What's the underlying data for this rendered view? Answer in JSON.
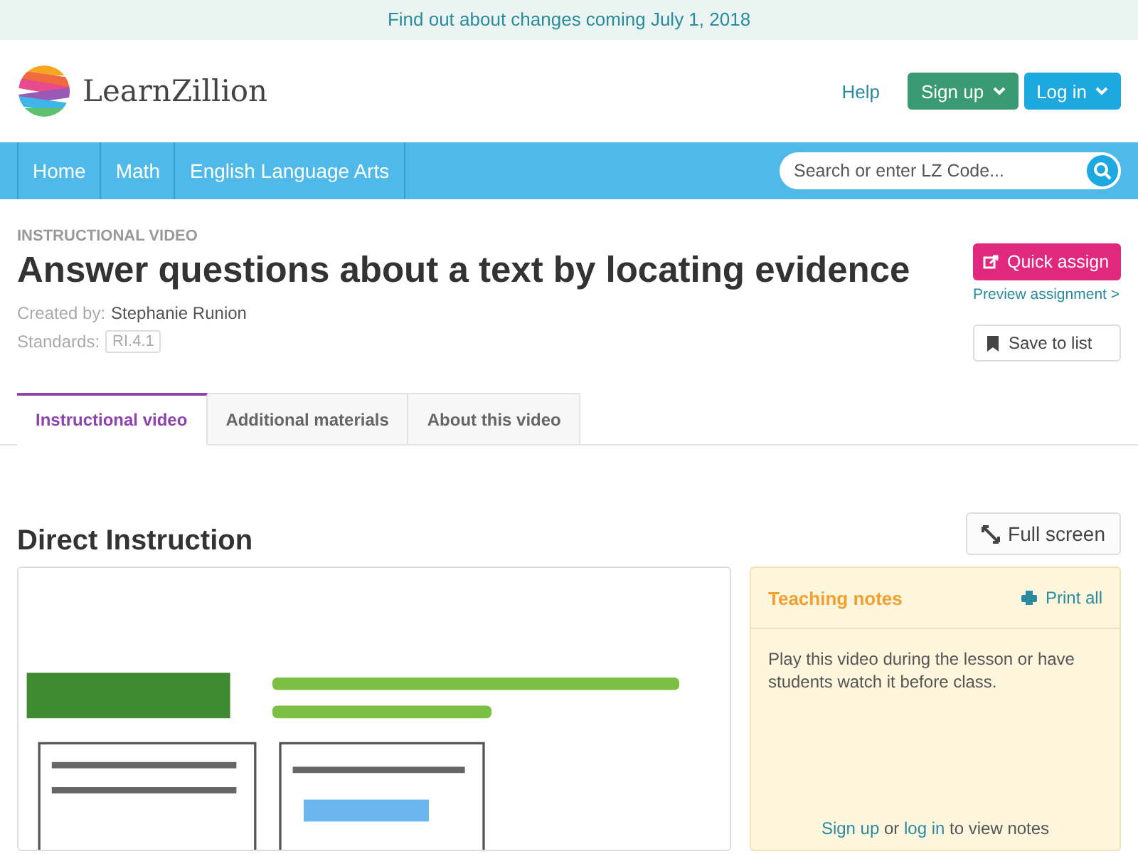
{
  "banner": {
    "text": "Find out about changes coming July 1, 2018"
  },
  "header": {
    "logo": "LearnZillion",
    "help": "Help",
    "buttons": [
      {
        "label": "Sign up",
        "kind": "green"
      },
      {
        "label": "Log in",
        "kind": "blue"
      }
    ]
  },
  "nav": {
    "items": [
      "Home",
      "Math",
      "English Language Arts"
    ],
    "search": {
      "placeholder": "Search or enter LZ Code..."
    }
  },
  "lesson": {
    "type": "INSTRUCTIONAL VIDEO",
    "title": "Answer questions about a text by locating evidence",
    "created_label": "Created by:",
    "author": "Stephanie Runion",
    "standards_label": "Standards:",
    "standard": "RI.4.1",
    "quick_assign": "Quick assign",
    "preview": "Preview assignment >",
    "save": "Save to list"
  },
  "tabs": [
    {
      "label": "Instructional video",
      "selected": true
    },
    {
      "label": "Additional materials",
      "selected": false
    },
    {
      "label": "About this video",
      "selected": false
    }
  ],
  "section": {
    "heading": "Direct Instruction",
    "full_screen": "Full screen"
  },
  "notes": {
    "title": "Teaching notes",
    "print": "Print all",
    "body": "Play this video during the lesson or have students watch it before class.",
    "sign_up": "Sign up",
    "or": "or",
    "log_in": "log in",
    "rest": "to view notes"
  }
}
